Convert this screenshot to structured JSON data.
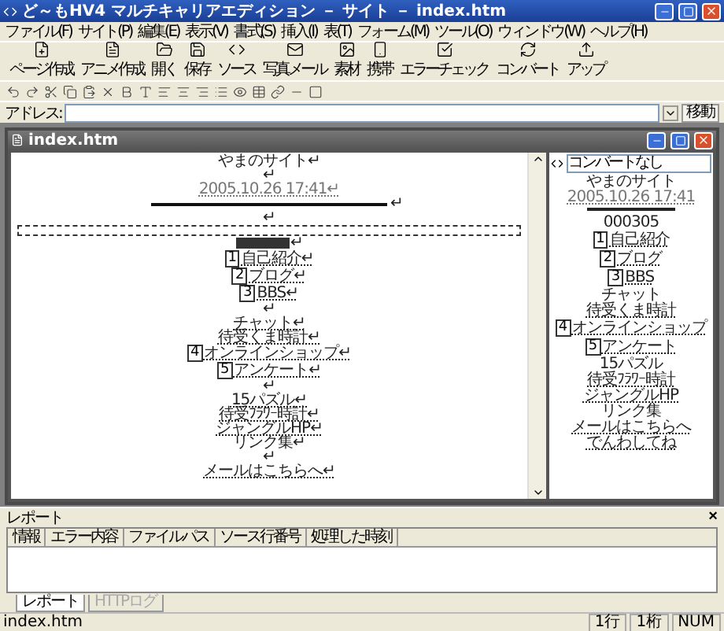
{
  "window": {
    "title": "ど～もHV4 マルチキャリアエディション － サイト － index.htm"
  },
  "menu": [
    "ファイル(F)",
    "サイト(P)",
    "編集(E)",
    "表示(V)",
    "書式(S)",
    "挿入(I)",
    "表(T)",
    "フォーム(M)",
    "ツール(O)",
    "ウィンドウ(W)",
    "ヘルプ(H)"
  ],
  "toolbar": [
    "ページ作成",
    "アニメ作成",
    "開く",
    "保存",
    "ソース",
    "写真メール",
    "素材",
    "携帯",
    "エラーチェック",
    "コンバート",
    "アップ"
  ],
  "address": {
    "label": "アドレス:",
    "go": "移動"
  },
  "document": {
    "title": "index.htm",
    "lines": [
      {
        "kind": "text",
        "text": "やまのサイト↵"
      },
      {
        "kind": "text",
        "text": "↵"
      },
      {
        "kind": "date",
        "text": "2005.10.26 17:41↵"
      },
      {
        "kind": "rule",
        "text": "↵"
      },
      {
        "kind": "text",
        "text": "↵"
      },
      {
        "kind": "dashed"
      },
      {
        "kind": "counter",
        "text": "↵"
      },
      {
        "kind": "item",
        "number": "1",
        "text": "自己紹介↵"
      },
      {
        "kind": "item",
        "number": "2",
        "text": "ブログ↵"
      },
      {
        "kind": "item",
        "number": "3",
        "text": "BBS↵"
      },
      {
        "kind": "text",
        "text": "↵"
      },
      {
        "kind": "link",
        "text": "チャット↵"
      },
      {
        "kind": "link",
        "text": "待受くま時計↵"
      },
      {
        "kind": "item",
        "number": "4",
        "text": "オンラインショップ↵"
      },
      {
        "kind": "item",
        "number": "5",
        "text": "アンケート↵"
      },
      {
        "kind": "text",
        "text": "↵"
      },
      {
        "kind": "link",
        "text": "15パズル↵"
      },
      {
        "kind": "link",
        "text": "待受ﾌﾗﾜｰ時計↵"
      },
      {
        "kind": "link",
        "text": "ジャングルHP↵"
      },
      {
        "kind": "text",
        "text": "リンク集↵"
      },
      {
        "kind": "text",
        "text": "↵"
      },
      {
        "kind": "link",
        "text": "メールはこちらへ↵"
      }
    ]
  },
  "preview": {
    "convert": "コンバートなし",
    "lines": [
      {
        "kind": "text",
        "text": "やまのサイト"
      },
      {
        "kind": "date",
        "text": "2005.10.26 17:41"
      },
      {
        "kind": "rule"
      },
      {
        "kind": "text",
        "text": "000305"
      },
      {
        "kind": "item",
        "number": "1",
        "text": "自己紹介"
      },
      {
        "kind": "item",
        "number": "2",
        "text": "ブログ"
      },
      {
        "kind": "item",
        "number": "3",
        "text": "BBS"
      },
      {
        "kind": "text",
        "text": "チャット"
      },
      {
        "kind": "link",
        "text": "待受くま時計"
      },
      {
        "kind": "item",
        "number": "4",
        "text": "オンラインショップ"
      },
      {
        "kind": "item",
        "number": "5",
        "text": "アンケート"
      },
      {
        "kind": "text",
        "text": "15パズル"
      },
      {
        "kind": "link",
        "text": "待受ﾌﾗﾜｰ時計"
      },
      {
        "kind": "link",
        "text": "ジャングルHP"
      },
      {
        "kind": "text",
        "text": "リンク集"
      },
      {
        "kind": "link",
        "text": "メールはこちらへ"
      },
      {
        "kind": "link",
        "text": "でんわしてね"
      }
    ]
  },
  "report": {
    "title": "レポート",
    "close": "×",
    "columns": [
      "情報",
      "エラー内容",
      "ファイルパス",
      "ソース行番号",
      "処理した時刻"
    ],
    "tabs": [
      {
        "label": "レポート",
        "selected": true
      },
      {
        "label": "HTTPログ",
        "selected": false
      }
    ]
  },
  "status_bar": [
    "index.htm",
    "1行",
    "1桁",
    "NUM"
  ]
}
